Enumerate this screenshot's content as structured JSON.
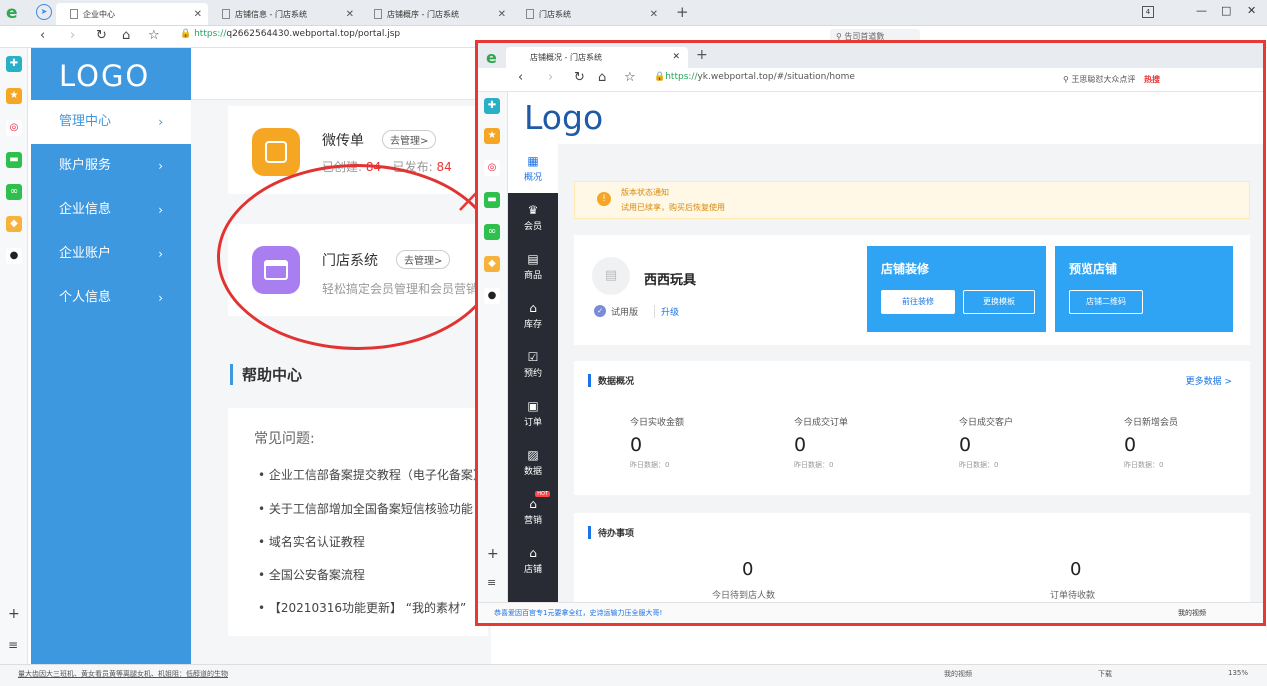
{
  "back_browser": {
    "tabs": [
      {
        "label": "企业中心",
        "active": true
      },
      {
        "label": "店铺信息 - 门店系统",
        "active": false
      },
      {
        "label": "店铺概序 - 门店系统",
        "active": false
      },
      {
        "label": "门店系统",
        "active": false
      }
    ],
    "new_tab": "+",
    "url_prefix": "https://",
    "url": "q2662564430.webportal.top/portal.jsp",
    "search_text": "告司首道數",
    "status_text": "量大齿因大三班机、黄女看员黄等离腿女机、机姐阻：低醇道的生物",
    "status_right": [
      "我的视频",
      "下载",
      "135%"
    ],
    "window_controls": [
      "4",
      "—",
      "□",
      "✕"
    ]
  },
  "portal": {
    "logo": "LOGO",
    "nav": [
      {
        "label": "管理中心",
        "active": true
      },
      {
        "label": "账户服务",
        "active": false
      },
      {
        "label": "企业信息",
        "active": false
      },
      {
        "label": "企业账户",
        "active": false
      },
      {
        "label": "个人信息",
        "active": false
      }
    ],
    "apps": [
      {
        "title": "微传单",
        "button": "去管理>",
        "created_label": "已创建:",
        "created": "84",
        "published_label": "已发布:",
        "published": "84"
      },
      {
        "title": "门店系统",
        "button": "去管理>",
        "desc": "轻松搞定会员管理和会员营销"
      }
    ],
    "help": {
      "title": "帮助中心",
      "faq_title": "常见问题:",
      "items": [
        "企业工信部备案提交教程（电子化备案）",
        "关于工信部增加全国备案短信核验功能",
        "域名实名认证教程",
        "全国公安备案流程",
        "【20210316功能更新】 “我的素材”"
      ]
    }
  },
  "front_browser": {
    "tab_label": "店铺概况 - 门店系统",
    "new_tab": "+",
    "url_prefix": "https://",
    "url": "yk.webportal.top/#/situation/home",
    "search_text": "王思聪怼大众点评",
    "hot_label": "热搜",
    "status_text": "恭喜爱因百官专1元要拿全红，史诗运输力压全服大哥!",
    "status_right": "我的视频",
    "logo": "Logo",
    "menu": [
      {
        "icon": "▦",
        "label": "概况",
        "active": true
      },
      {
        "icon": "♛",
        "label": "会员",
        "active": false
      },
      {
        "icon": "▤",
        "label": "商品",
        "active": false
      },
      {
        "icon": "⌂",
        "label": "库存",
        "active": false
      },
      {
        "icon": "☑",
        "label": "预约",
        "active": false
      },
      {
        "icon": "▣",
        "label": "订单",
        "active": false
      },
      {
        "icon": "▨",
        "label": "数据",
        "active": false
      },
      {
        "icon": "⌂",
        "label": "营销",
        "active": false,
        "badge": "HOT"
      },
      {
        "icon": "⌂",
        "label": "店铺",
        "active": false
      }
    ],
    "notice": {
      "title": "版本状态通知",
      "text": "试用已续享，购买后恢复使用"
    },
    "store": {
      "name": "西西玩具",
      "version": "试用版",
      "upgrade": "升级"
    },
    "promo1": {
      "title": "店铺装修",
      "btn1": "前往装修",
      "btn2": "更换模板"
    },
    "promo2": {
      "title": "预览店铺",
      "btn1": "店铺二维码"
    },
    "data": {
      "title": "数据概况",
      "more": "更多数据 >",
      "stats": [
        {
          "label": "今日实收金额",
          "value": "0",
          "sub": "昨日数据：0"
        },
        {
          "label": "今日成交订单",
          "value": "0",
          "sub": "昨日数据：0"
        },
        {
          "label": "今日成交客户",
          "value": "0",
          "sub": "昨日数据：0"
        },
        {
          "label": "今日新增会员",
          "value": "0",
          "sub": "昨日数据：0"
        }
      ]
    },
    "todo": {
      "title": "待办事项",
      "items": [
        {
          "value": "0",
          "label": "今日待到店人数"
        },
        {
          "value": "0",
          "label": "订单待收款"
        }
      ]
    }
  },
  "colors": {
    "accent": "#3e98e0",
    "annotation": "#e53935",
    "dark_menu": "#282b33",
    "promo": "#2fa4f5"
  }
}
